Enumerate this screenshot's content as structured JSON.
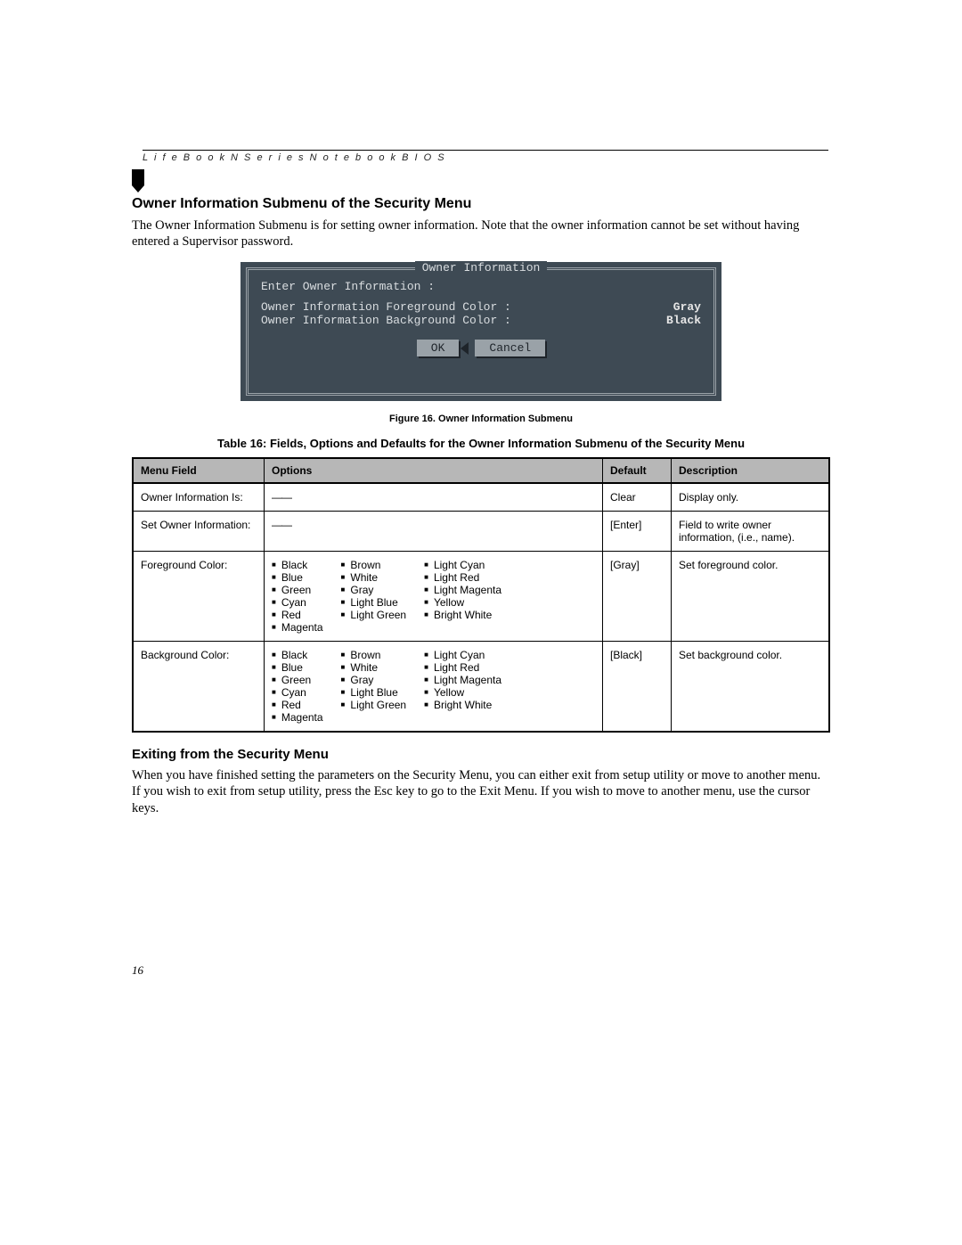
{
  "running_head": "L i f e B o o k   N   S e r i e s   N o t e b o o k   B I O S",
  "section1": {
    "title": "Owner Information Submenu of the Security Menu",
    "body": "The Owner Information Submenu is for setting owner information. Note that the owner information cannot be set without having entered a Supervisor password."
  },
  "bios": {
    "title": "Owner Information",
    "enter_label": "Enter Owner Information :",
    "fg_label": "Owner Information Foreground Color :",
    "fg_value": "Gray",
    "bg_label": "Owner Information Background Color :",
    "bg_value": "Black",
    "ok": "OK",
    "cancel": "Cancel"
  },
  "figure_caption": "Figure 16.  Owner Information Submenu",
  "table_caption": "Table 16: Fields, Options and Defaults for the Owner Information Submenu of the Security Menu",
  "table": {
    "headers": {
      "field": "Menu Field",
      "options": "Options",
      "default": "Default",
      "desc": "Description"
    },
    "rows": [
      {
        "field": "Owner Information Is:",
        "options_dash": "——",
        "default": "Clear",
        "desc": "Display only."
      },
      {
        "field": "Set Owner Information:",
        "options_dash": "——",
        "default": "[Enter]",
        "desc": "Field to write owner information, (i.e., name)."
      },
      {
        "field": "Foreground Color:",
        "options_cols": [
          [
            "Black",
            "Blue",
            "Green",
            "Cyan",
            "Red",
            "Magenta"
          ],
          [
            "Brown",
            "White",
            "Gray",
            "Light Blue",
            "Light Green"
          ],
          [
            "Light Cyan",
            "Light Red",
            "Light Magenta",
            "Yellow",
            "Bright White"
          ]
        ],
        "default": "[Gray]",
        "desc": "Set foreground color."
      },
      {
        "field": "Background Color:",
        "options_cols": [
          [
            "Black",
            "Blue",
            "Green",
            "Cyan",
            "Red",
            "Magenta"
          ],
          [
            "Brown",
            "White",
            "Gray",
            "Light Blue",
            "Light Green"
          ],
          [
            "Light Cyan",
            "Light Red",
            "Light Magenta",
            "Yellow",
            "Bright White"
          ]
        ],
        "default": "[Black]",
        "desc": "Set background color."
      }
    ]
  },
  "section2": {
    "title": "Exiting from the Security Menu",
    "body": "When you have finished setting the parameters on the Security Menu, you can either exit from setup utility or move to another menu. If you wish to exit from setup utility, press the Esc key to go to the Exit Menu. If you wish to move to another menu, use the cursor keys."
  },
  "page_number": "16"
}
